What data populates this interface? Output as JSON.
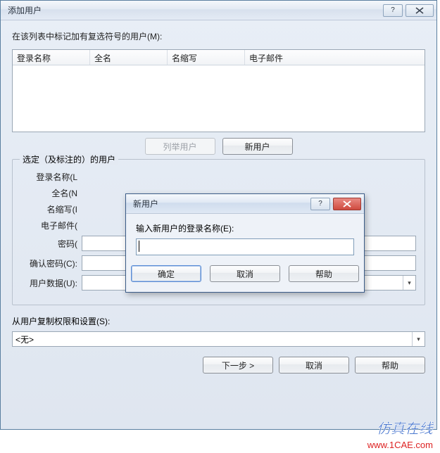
{
  "main": {
    "title": "添加用户",
    "instruction": "在该列表中标记加有复选符号的用户(M):",
    "table": {
      "cols": {
        "login": "登录名称",
        "full": "全名",
        "abbr": "名缩写",
        "email": "电子邮件"
      }
    },
    "buttons": {
      "list_users": "列举用户",
      "new_user": "新用户",
      "next": "下一步 >",
      "cancel": "取消",
      "help": "帮助"
    },
    "group": {
      "legend": "选定（及标注的）的用户",
      "labels": {
        "login": "登录名称(L",
        "full": "全名(N",
        "abbr": "名缩写(I",
        "email": "电子邮件(",
        "password": "密码(",
        "confirm": "确认密码(C):",
        "userdata": "用户数据(U):"
      }
    },
    "copy": {
      "label": "从用户复制权限和设置(S):",
      "value": "<无>"
    }
  },
  "modal": {
    "title": "新用户",
    "prompt": "输入新用户的登录名称(E):",
    "value": "",
    "buttons": {
      "ok": "确定",
      "cancel": "取消",
      "help": "帮助"
    }
  },
  "watermark": {
    "bg": ".COM",
    "text": "仿真在线",
    "url": "www.1CAE.com"
  }
}
